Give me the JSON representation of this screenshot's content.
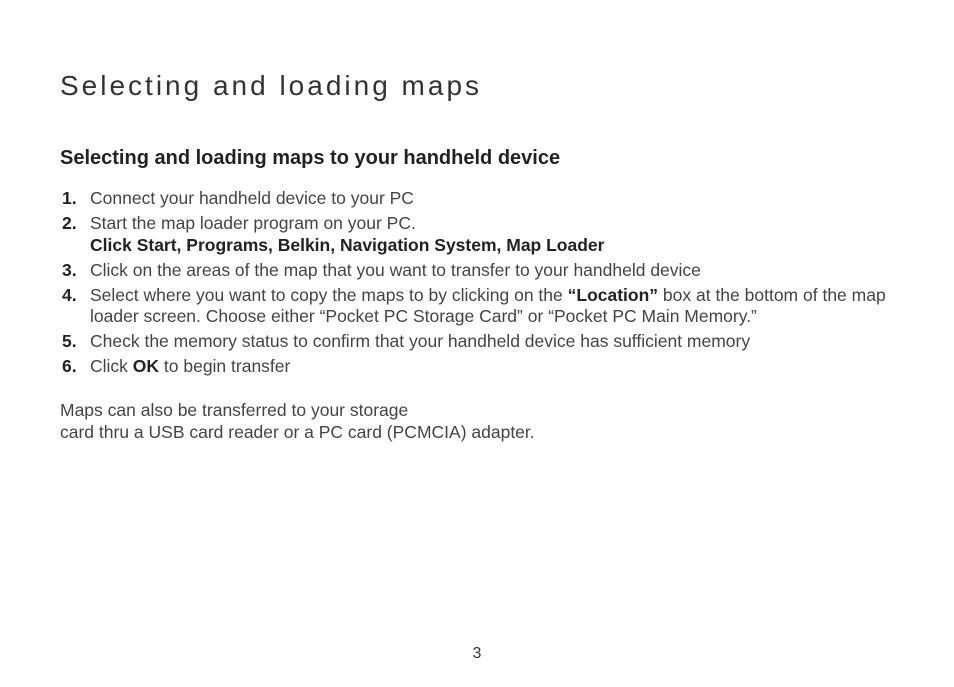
{
  "title": "Selecting and loading maps",
  "subtitle": "Selecting and loading maps to your handheld device",
  "steps": {
    "s1": "Connect your handheld device to your PC",
    "s2a": "Start the map loader program on your PC.",
    "s2b": "Click Start, Programs, Belkin, Navigation System, Map Loader",
    "s3": "Click on the areas of the map that you want to transfer to your handheld device",
    "s4a": "Select where you want to copy the maps to by clicking on the ",
    "s4b": "“Location”",
    "s4c": " box at the bottom of the map loader screen. Choose either “Pocket PC Storage Card” or “Pocket PC Main Memory.”",
    "s5": "Check the memory status to confirm that your handheld device has sufficient memory",
    "s6a": "Click ",
    "s6b": "OK",
    "s6c": " to begin transfer"
  },
  "note_line1": "Maps can also be transferred to your storage",
  "note_line2": "card thru a USB card reader or a PC card (PCMCIA) adapter.",
  "page_number": "3"
}
